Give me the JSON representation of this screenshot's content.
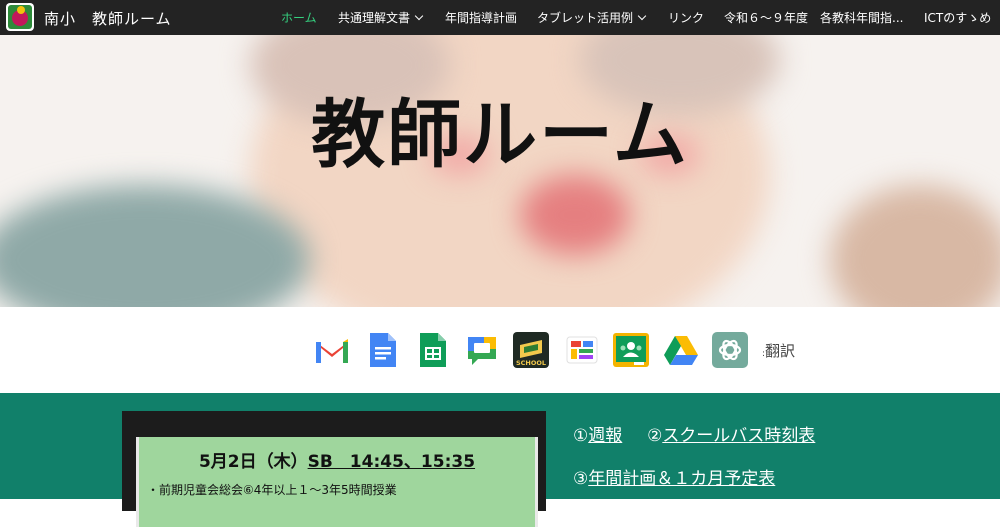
{
  "header": {
    "site_title": "南小　教師ルーム",
    "nav": [
      {
        "label": "ホーム",
        "active": true,
        "dropdown": false
      },
      {
        "label": "共通理解文書",
        "active": false,
        "dropdown": true
      },
      {
        "label": "年間指導計画",
        "active": false,
        "dropdown": false
      },
      {
        "label": "タブレット活用例",
        "active": false,
        "dropdown": true
      },
      {
        "label": "リンク",
        "active": false,
        "dropdown": false
      },
      {
        "label": "令和６～９年度",
        "active": false,
        "dropdown": false
      },
      {
        "label": "各教科年間指...",
        "active": false,
        "dropdown": false
      },
      {
        "label": "ICTのすゝめ",
        "active": false,
        "dropdown": false
      }
    ]
  },
  "hero": {
    "title": "教師ルーム"
  },
  "apps": {
    "items": [
      {
        "name": "gmail-icon"
      },
      {
        "name": "google-docs-icon"
      },
      {
        "name": "google-sheets-icon"
      },
      {
        "name": "google-chat-icon"
      },
      {
        "name": "school-app-icon",
        "text": "SCHOOL"
      },
      {
        "name": "whiteboard-icon"
      },
      {
        "name": "google-classroom-icon"
      },
      {
        "name": "google-drive-icon"
      },
      {
        "name": "chatgpt-icon"
      }
    ],
    "translate_label": "翻訳"
  },
  "board": {
    "date": "5月2日（木）",
    "time": "SB　14:45、15:35",
    "note": "・前期児童会総会⑥4年以上１～3年5時間授業"
  },
  "links": {
    "weekly_prefix": "①",
    "weekly": "週報",
    "bus_prefix": "②",
    "bus": "スクールバス時刻表",
    "plan_prefix": "③",
    "plan": "年間計画＆１カ月予定表"
  },
  "colors": {
    "nav_bg": "#232323",
    "nav_active": "#35d07f",
    "section_green": "#11806a",
    "board_green": "#9fd69d"
  }
}
